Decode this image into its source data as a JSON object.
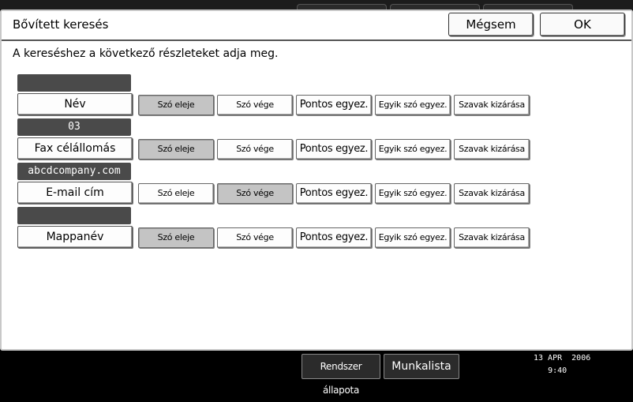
{
  "dialog": {
    "title": "Bővített keresés",
    "cancel_label": "Mégsem",
    "ok_label": "OK",
    "instruction": "A kereséshez a következő részleteket adja meg."
  },
  "options": [
    "Szó eleje",
    "Szó vége",
    "Pontos egyez.",
    "Egyik szó egyez.",
    "Szavak kizárása"
  ],
  "rows": [
    {
      "label": "Név",
      "value": "",
      "selected": "Szó eleje"
    },
    {
      "label": "Fax célállomás",
      "value": "03",
      "selected": "Szó eleje"
    },
    {
      "label": "E-mail cím",
      "value": "abcdcompany.com",
      "selected": "Szó vége"
    },
    {
      "label": "Mappanév",
      "value": "",
      "selected": "Szó eleje"
    }
  ],
  "status_bar": {
    "system_status_label": "Rendszer állapota",
    "job_list_label": "Munkalista",
    "date": "13 APR  2006",
    "time": "9:40"
  }
}
